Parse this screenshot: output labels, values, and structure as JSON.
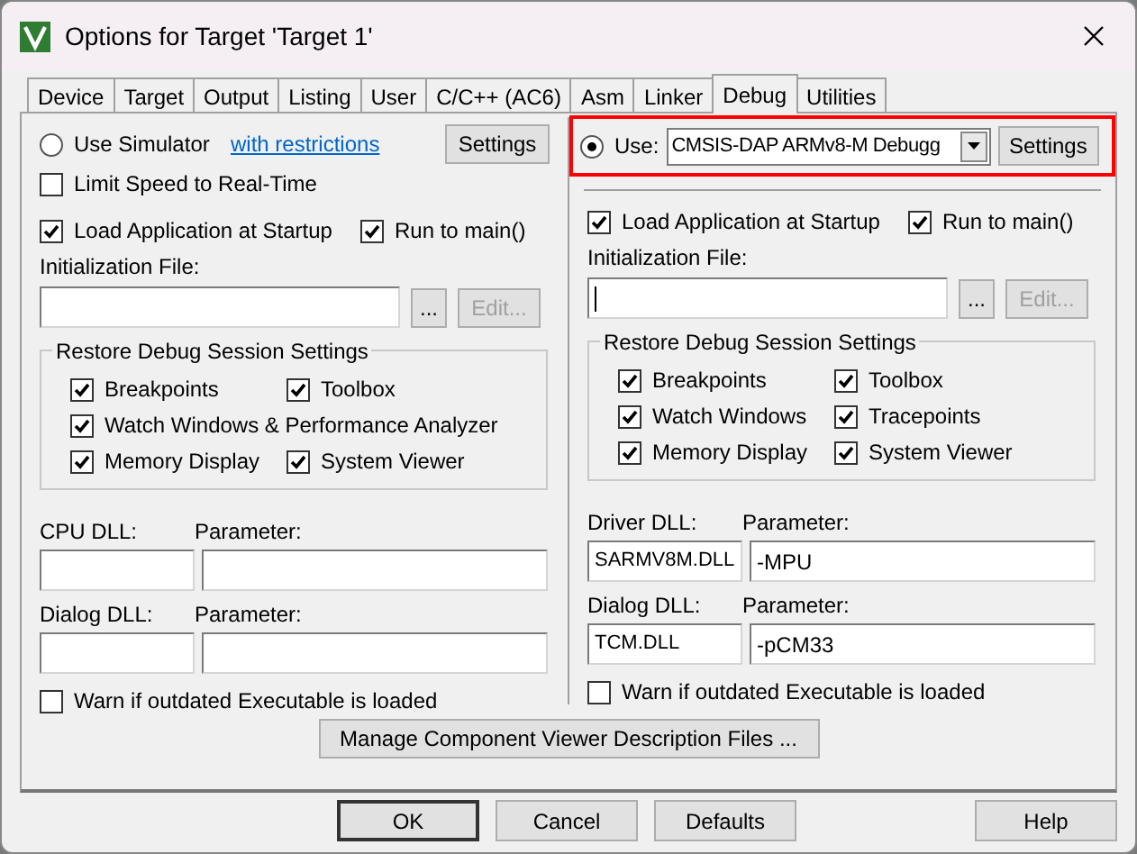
{
  "window": {
    "title": "Options for Target 'Target 1'"
  },
  "tabs": [
    {
      "label": "Device",
      "selected": false
    },
    {
      "label": "Target",
      "selected": false
    },
    {
      "label": "Output",
      "selected": false
    },
    {
      "label": "Listing",
      "selected": false
    },
    {
      "label": "User",
      "selected": false
    },
    {
      "label": "C/C++ (AC6)",
      "selected": false
    },
    {
      "label": "Asm",
      "selected": false
    },
    {
      "label": "Linker",
      "selected": false
    },
    {
      "label": "Debug",
      "selected": true
    },
    {
      "label": "Utilities",
      "selected": false
    }
  ],
  "left": {
    "kind": "simulator",
    "mode": {
      "label": "Use Simulator",
      "selected": false
    },
    "link": "with restrictions",
    "settings_button": "Settings",
    "limit_speed": {
      "label": "Limit Speed to Real-Time",
      "checked": false
    },
    "load_app": {
      "label": "Load Application at Startup",
      "checked": true
    },
    "run_to_main": {
      "label": "Run to main()",
      "checked": true
    },
    "init_label": "Initialization File:",
    "browse_button": "...",
    "edit_button": {
      "label": "Edit...",
      "disabled": true
    },
    "restore": {
      "title": "Restore Debug Session Settings",
      "rows": [
        [
          {
            "label": "Breakpoints",
            "checked": true
          },
          {
            "label": "Toolbox",
            "checked": true
          }
        ],
        [
          {
            "label": "Watch Windows & Performance Analyzer",
            "checked": true
          }
        ],
        [
          {
            "label": "Memory Display",
            "checked": true
          },
          {
            "label": "System Viewer",
            "checked": true
          }
        ]
      ]
    },
    "dll_rows": [
      {
        "dll_label": "CPU DLL:",
        "param_label": "Parameter:"
      },
      {
        "dll_label": "Dialog DLL:",
        "param_label": "Parameter:"
      }
    ],
    "warn": {
      "label": "Warn if outdated Executable is loaded",
      "checked": false
    }
  },
  "right": {
    "kind": "target",
    "highlighted": true,
    "mode": {
      "label": "Use:",
      "selected": true
    },
    "driver": "CMSIS-DAP ARMv8-M Debugg",
    "settings_button": "Settings",
    "load_app": {
      "label": "Load Application at Startup",
      "checked": true
    },
    "run_to_main": {
      "label": "Run to main()",
      "checked": true
    },
    "init_label": "Initialization File:",
    "browse_button": "...",
    "edit_button": {
      "label": "Edit...",
      "disabled": true
    },
    "restore": {
      "title": "Restore Debug Session Settings",
      "rows": [
        [
          {
            "label": "Breakpoints",
            "checked": true
          },
          {
            "label": "Toolbox",
            "checked": true
          }
        ],
        [
          {
            "label": "Watch Windows",
            "checked": true
          },
          {
            "label": "Tracepoints",
            "checked": true
          }
        ],
        [
          {
            "label": "Memory Display",
            "checked": true
          },
          {
            "label": "System Viewer",
            "checked": true
          }
        ]
      ]
    },
    "dll_rows": [
      {
        "dll_label": "Driver DLL:",
        "dll_value": "SARMV8M.DLL",
        "param_label": "Parameter:",
        "param_value": "-MPU"
      },
      {
        "dll_label": "Dialog DLL:",
        "dll_value": "TCM.DLL",
        "param_label": "Parameter:",
        "param_value": "-pCM33"
      }
    ],
    "warn": {
      "label": "Warn if outdated Executable is loaded",
      "checked": false
    }
  },
  "manage_button": "Manage Component Viewer Description Files ...",
  "buttons": [
    {
      "label": "OK",
      "kind": "default"
    },
    {
      "label": "Cancel",
      "kind": "normal"
    },
    {
      "label": "Defaults",
      "kind": "normal"
    },
    {
      "label": "Help",
      "kind": "help"
    }
  ]
}
